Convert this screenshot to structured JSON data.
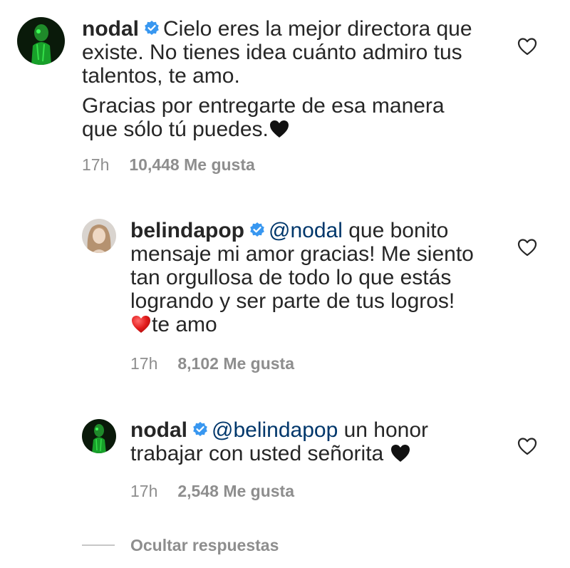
{
  "comments": [
    {
      "username": "nodal",
      "mention": "",
      "line1": "Cielo eres la mejor directora que",
      "line2": "existe. No tienes idea cuánto admiro tus",
      "line3": "talentos, te amo.",
      "para2_line1": "Gracias por entregarte de esa manera",
      "para2_line2": "que sólo tú puedes.",
      "time": "17h",
      "likes": "10,448 Me gusta",
      "emoji": "black-heart"
    },
    {
      "username": "belindapop",
      "mention": "@nodal",
      "line1": " que bonito",
      "line2": "mensaje mi amor gracias! Me siento",
      "line3": "tan orgullosa de todo lo que estás",
      "line4": "logrando y ser parte de tus logros!",
      "line5": "te amo",
      "time": "17h",
      "likes": "8,102 Me gusta",
      "emoji": "red-heart"
    },
    {
      "username": "nodal",
      "mention": "@belindapop",
      "line1": " un honor",
      "line2": "trabajar con usted señorita",
      "time": "17h",
      "likes": "2,548 Me gusta",
      "emoji": "black-heart"
    }
  ],
  "hide_replies": "Ocultar respuestas",
  "icons": {
    "verified": "verified-badge-icon",
    "like": "heart-outline-icon"
  },
  "colors": {
    "verified": "#3897f0",
    "mention": "#00376b",
    "secondary_text": "#8e8e8e",
    "primary_text": "#262626"
  }
}
